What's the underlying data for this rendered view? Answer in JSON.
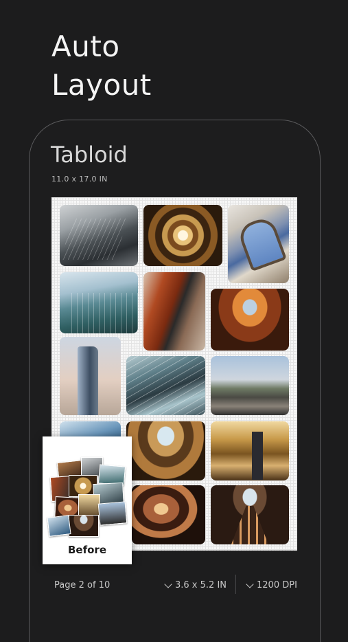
{
  "headline": {
    "line1": "Auto",
    "line2": "Layout"
  },
  "paper": {
    "name": "Tabloid",
    "dimensions": "11.0 x 17.0 IN"
  },
  "before_card": {
    "label": "Before"
  },
  "footer": {
    "page_label": "Page 2 of 10",
    "photo_size": "3.6 x 5.2 IN",
    "resolution": "1200 DPI"
  },
  "icons": [
    "chevron-down-icon"
  ]
}
